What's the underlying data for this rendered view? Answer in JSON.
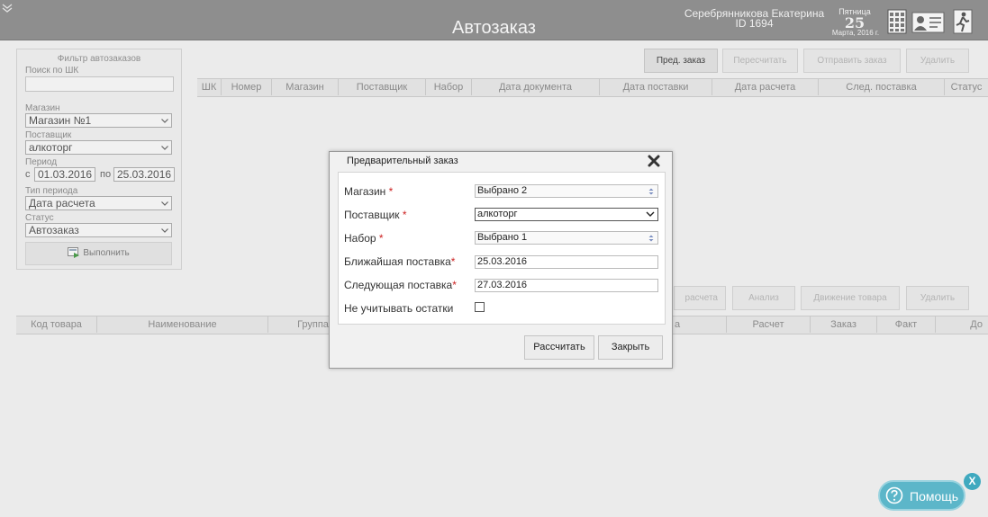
{
  "header": {
    "title": "Автозаказ",
    "user_name": "Серебрянникова Екатерина",
    "user_id": "ID 1694",
    "day_name": "Пятница",
    "day_number": "25",
    "month_year": "Марта, 2016 г.",
    "icons": [
      "calculator-icon",
      "id-card-icon",
      "exit-icon"
    ]
  },
  "filter": {
    "title": "Фильтр автозаказов",
    "search_label": "Поиск по ШК",
    "search_value": "",
    "shop_label": "Магазин",
    "shop_value": "Магазин №1",
    "supplier_label": "Поставщик",
    "supplier_value": "алкоторг",
    "period_label": "Период",
    "period_from_label": "с",
    "period_from": "01.03.2016",
    "period_to_label": "по",
    "period_to": "25.03.2016",
    "period_type_label": "Тип периода",
    "period_type_value": "Дата расчета",
    "status_label": "Статус",
    "status_value": "Автозаказ",
    "run_button": "Выполнить"
  },
  "top_toolbar": {
    "pre_order": "Пред. заказ",
    "recalc": "Пересчитать",
    "send_order": "Отправить заказ",
    "delete": "Удалить"
  },
  "top_table": {
    "columns": [
      "ШК",
      "Номер",
      "Магазин",
      "Поставщик",
      "Набор",
      "Дата документа",
      "Дата поставки",
      "Дата расчета",
      "След. поставка",
      "Статус"
    ]
  },
  "bottom_toolbar": {
    "calc_data": "расчета",
    "analysis": "Анализ",
    "movement": "Движение товара",
    "delete": "Удалить"
  },
  "bottom_table": {
    "columns": [
      "Код товара",
      "Наименование",
      "Группа",
      "а",
      "Расчет",
      "Заказ",
      "Факт",
      "До"
    ]
  },
  "modal": {
    "title": "Предварительный заказ",
    "shop_label": "Магазин",
    "shop_value": "Выбрано 2",
    "supplier_label": "Поставщик",
    "supplier_value": "алкоторг",
    "set_label": "Набор",
    "set_value": "Выбрано 1",
    "nearest_label": "Ближайшая поставка",
    "nearest_value": "25.03.2016",
    "next_label": "Следующая поставка",
    "next_value": "27.03.2016",
    "ignore_label": "Не учитывать остатки",
    "ignore_checked": false,
    "required_mark": "*",
    "calc_button": "Рассчитать",
    "close_button": "Закрыть"
  },
  "help": {
    "label": "Помощь",
    "close": "X"
  },
  "colors": {
    "header_bg": "#8e8e8e",
    "help_bg": "#5cb6c9",
    "required": "#cc2222"
  }
}
